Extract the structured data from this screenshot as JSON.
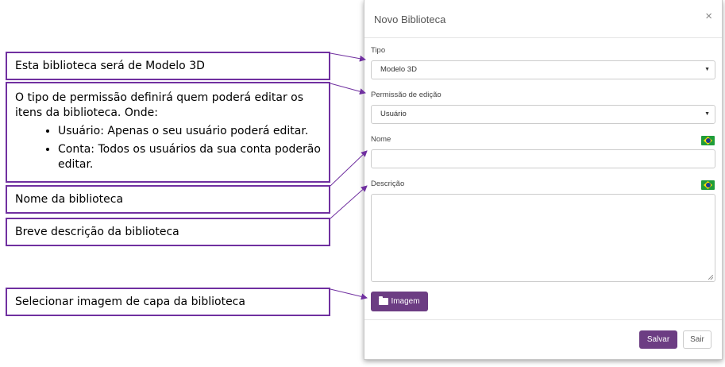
{
  "callouts": {
    "type_note": "Esta biblioteca será de Modelo 3D",
    "permission_note": "O tipo de permissão definirá quem poderá editar os itens da biblioteca. Onde:",
    "permission_items": [
      "Usuário: Apenas o seu usuário poderá editar.",
      "Conta: Todos os usuários da sua conta poderão editar."
    ],
    "name_note": "Nome da biblioteca",
    "description_note": "Breve descrição da biblioteca",
    "image_note": "Selecionar imagem de capa da biblioteca"
  },
  "modal": {
    "title": "Novo Biblioteca",
    "close_symbol": "×",
    "type_label": "Tipo",
    "type_value": "Modelo 3D",
    "permission_label": "Permissão de edição",
    "permission_value": "Usuário",
    "name_label": "Nome",
    "name_value": "",
    "description_label": "Descrição",
    "description_value": "",
    "image_button": "Imagem",
    "save_button": "Salvar",
    "exit_button": "Sair",
    "caret_symbol": "▼"
  },
  "colors": {
    "annotation_border": "#7030a0",
    "accent": "#6c3d83"
  },
  "icons": [
    "close-icon",
    "chevron-down-icon",
    "brazil-flag-icon",
    "folder-open-icon",
    "resize-handle-icon"
  ]
}
